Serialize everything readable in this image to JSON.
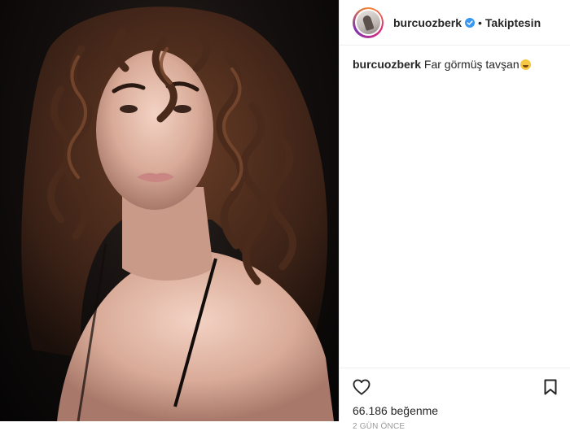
{
  "post": {
    "photo_alt": "Photo",
    "header": {
      "username": "burcuozberk",
      "separator": "•",
      "follow_status": "Takiptesin"
    },
    "caption": {
      "username": "burcuozberk",
      "text": "Far görmüş tavşan"
    },
    "likes": {
      "count": "66.186",
      "label": "beğenme"
    },
    "date": "2 GÜN ÖNCE"
  },
  "colors": {
    "accent_verified": "#3897f0",
    "text": "#262626",
    "border": "#efefef"
  },
  "icons": [
    "verified-badge-icon",
    "heart-icon",
    "bookmark-icon"
  ]
}
